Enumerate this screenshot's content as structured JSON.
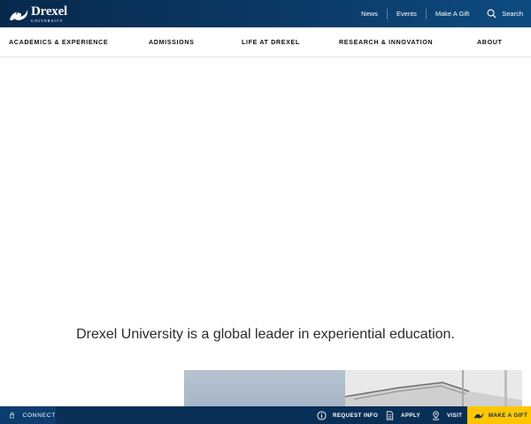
{
  "header": {
    "logo": {
      "name": "Drexel",
      "sub": "UNIVERSITY"
    },
    "utility": [
      {
        "label": "News"
      },
      {
        "label": "Events"
      },
      {
        "label": "Make A Gift"
      }
    ],
    "search_label": "Search"
  },
  "nav": {
    "items": [
      {
        "label": "ACADEMICS & EXPERIENCE"
      },
      {
        "label": "ADMISSIONS"
      },
      {
        "label": "LIFE AT DREXEL"
      },
      {
        "label": "RESEARCH & INNOVATION"
      },
      {
        "label": "ABOUT"
      }
    ]
  },
  "hero": {
    "tagline": "Drexel University is a global leader in experiential education."
  },
  "footer_bar": {
    "connect": "CONNECT",
    "request_info": "REQUEST INFO",
    "apply": "APPLY",
    "visit": "VISIT",
    "make_gift": "MAKE A GIFT"
  },
  "colors": {
    "navy": "#07294d",
    "gold": "#ffc600"
  }
}
